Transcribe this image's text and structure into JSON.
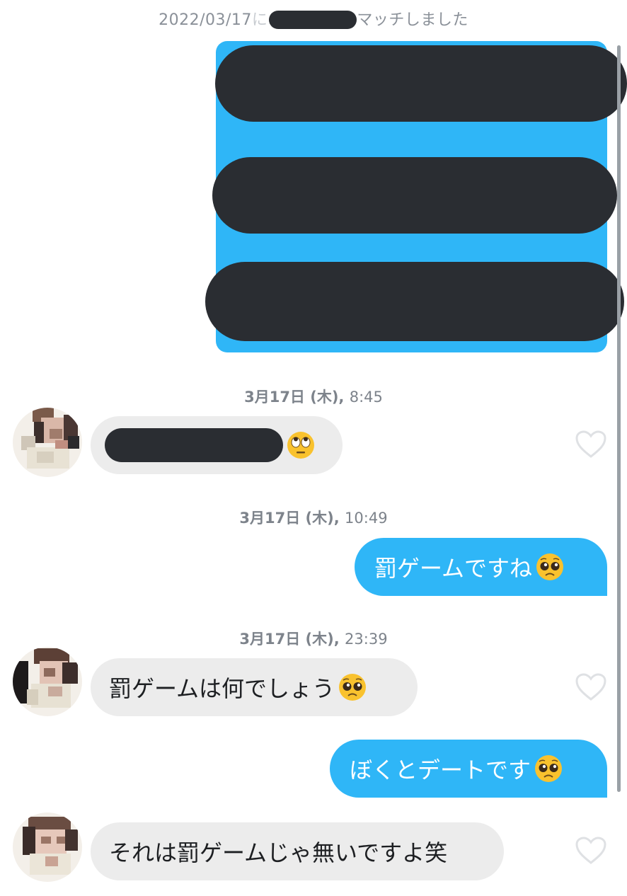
{
  "match_banner": {
    "date": "2022/03/17",
    "sep": "に",
    "text": "マッチしました"
  },
  "messages": [
    {
      "timestamp_date": "3月17日 (木),",
      "timestamp_time": "8:45"
    },
    {
      "timestamp_date": "3月17日 (木),",
      "timestamp_time": "10:49",
      "text": "罰ゲームですね"
    },
    {
      "timestamp_date": "3月17日 (木),",
      "timestamp_time": "23:39",
      "text": "罰ゲームは何でしょう"
    },
    {
      "text": "ぼくとデートです"
    },
    {
      "text": "それは罰ゲームじゃ無いですよ笑"
    }
  ],
  "icons": {
    "like": "heart-outline-icon",
    "emoji_rolling": "face-with-rolling-eyes-icon",
    "emoji_pleading": "pleading-face-icon"
  },
  "colors": {
    "sent_bubble": "#2fb6f7",
    "received_bubble": "#ececec",
    "redaction": "#2a2d32",
    "timestamp": "#7d838b"
  }
}
